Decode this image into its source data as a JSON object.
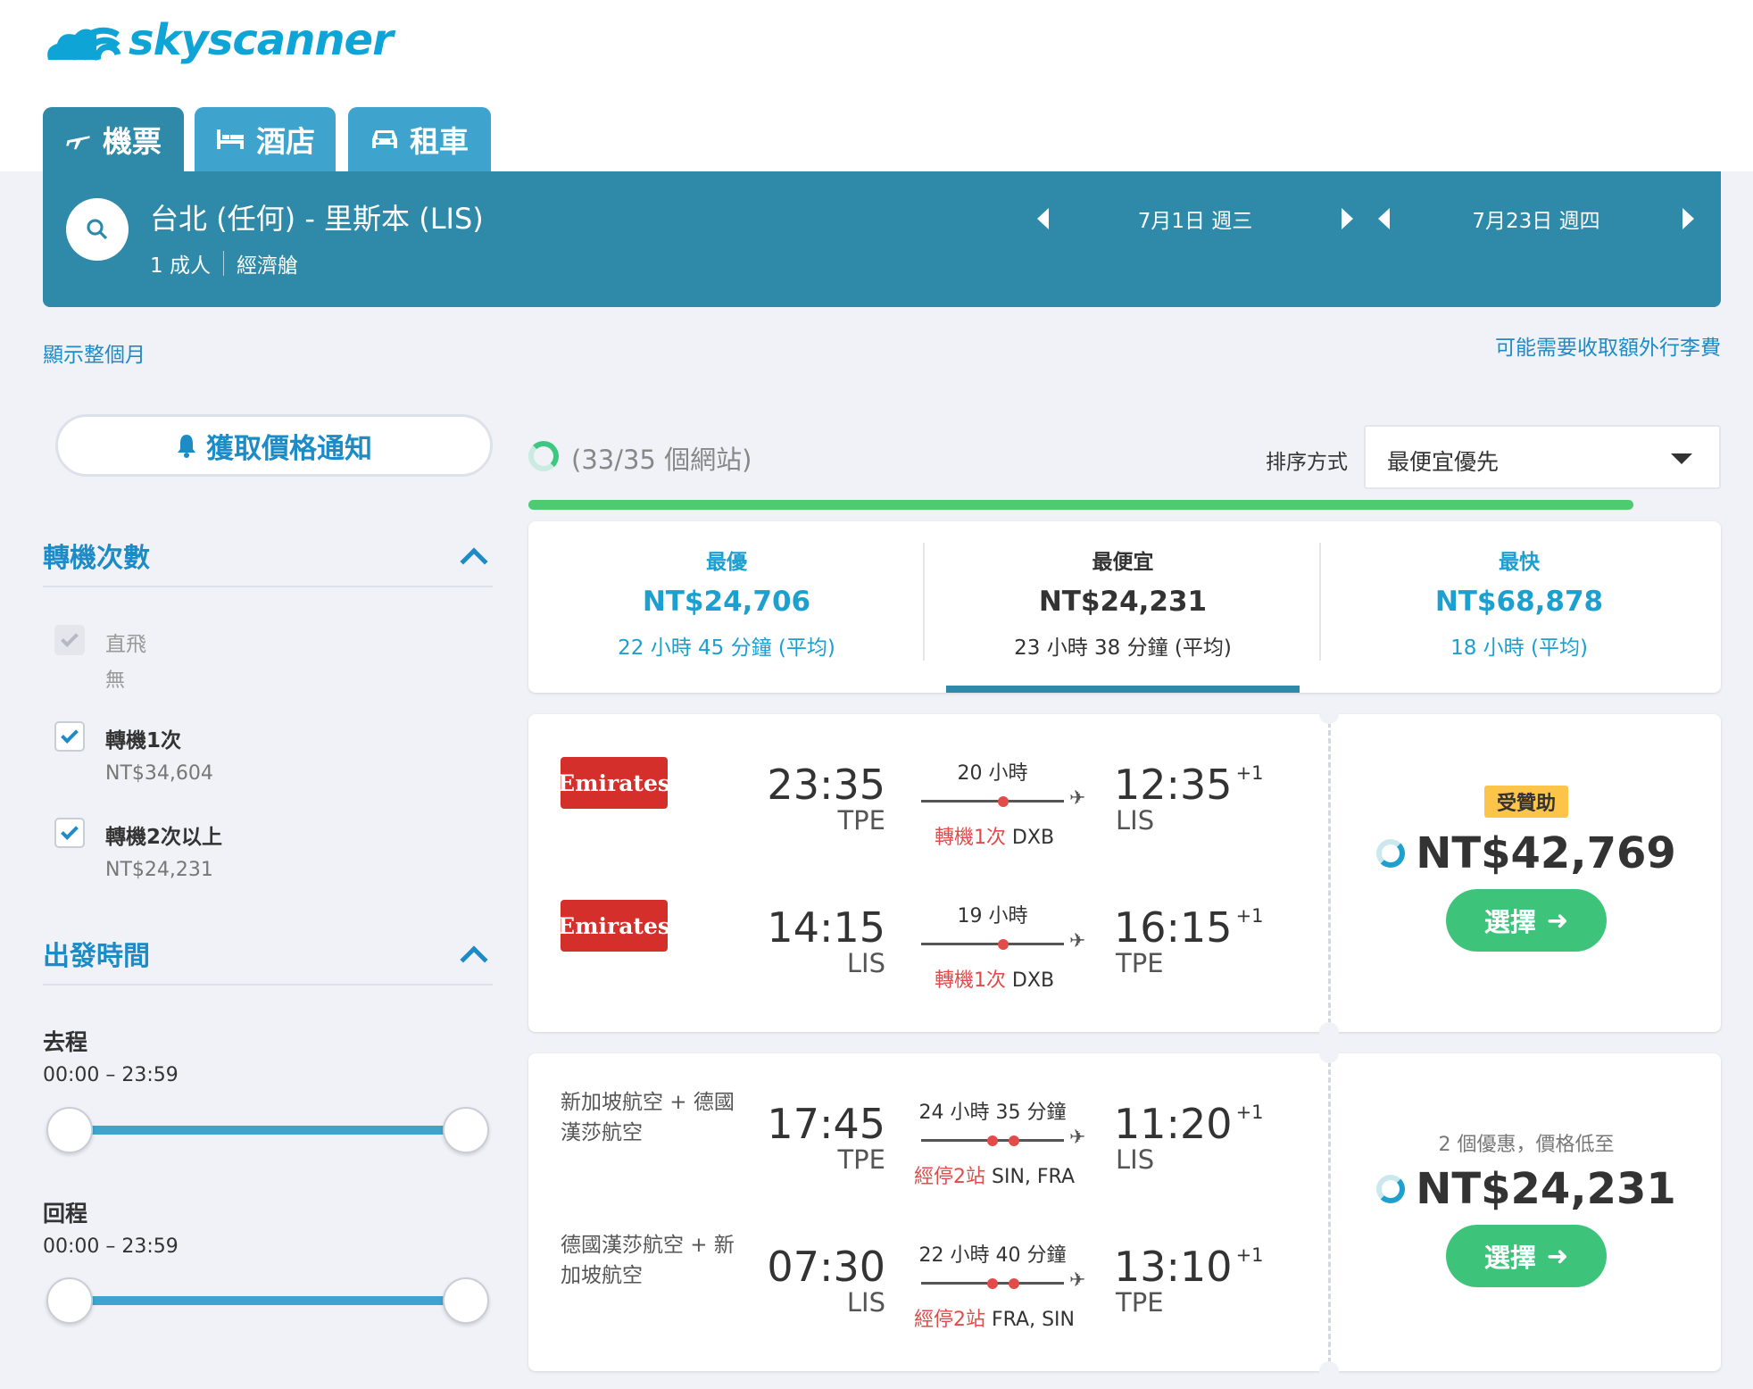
{
  "header": {
    "logo_text": "skyscanner",
    "tabs": [
      {
        "label": "機票",
        "icon": "plane-icon"
      },
      {
        "label": "酒店",
        "icon": "bed-icon"
      },
      {
        "label": "租車",
        "icon": "car-icon"
      }
    ]
  },
  "search": {
    "route": "台北 (任何) - 里斯本 (LIS)",
    "passengers": "1 成人",
    "cabin": "經濟艙",
    "depart_date": "7月1日 週三",
    "return_date": "7月23日 週四"
  },
  "links": {
    "show_month": "顯示整個月",
    "baggage_fee": "可能需要收取額外行李費"
  },
  "sidebar": {
    "price_alert": "獲取價格通知",
    "stops_title": "轉機次數",
    "stops": [
      {
        "label": "直飛",
        "price": "無",
        "checked": true,
        "disabled": true
      },
      {
        "label": "轉機1次",
        "price": "NT$34,604",
        "checked": true,
        "disabled": false
      },
      {
        "label": "轉機2次以上",
        "price": "NT$24,231",
        "checked": true,
        "disabled": false
      }
    ],
    "depart_title": "出發時間",
    "outbound_label": "去程",
    "outbound_range": "00:00 – 23:59",
    "return_label": "回程",
    "return_range": "00:00 – 23:59"
  },
  "results_header": {
    "site_progress": "(33/35 個網站)",
    "sort_label": "排序方式",
    "sort_value": "最便宜優先"
  },
  "summary": [
    {
      "title": "最優",
      "price": "NT$24,706",
      "duration": "22 小時 45 分鐘 (平均)"
    },
    {
      "title": "最便宜",
      "price": "NT$24,231",
      "duration": "23 小時 38 分鐘 (平均)"
    },
    {
      "title": "最快",
      "price": "NT$68,878",
      "duration": "18 小時 (平均)"
    }
  ],
  "results": [
    {
      "badge": "受贊助",
      "price": "NT$42,769",
      "select_label": "選擇",
      "legs": [
        {
          "airline": "Emirates",
          "dep_time": "23:35",
          "dep_airport": "TPE",
          "duration": "20 小時",
          "arr_time": "12:35",
          "day_offset": "+1",
          "arr_airport": "LIS",
          "stops_red": "轉機1次",
          "stops_via": " DXB"
        },
        {
          "airline": "Emirates",
          "dep_time": "14:15",
          "dep_airport": "LIS",
          "duration": "19 小時",
          "arr_time": "16:15",
          "day_offset": "+1",
          "arr_airport": "TPE",
          "stops_red": "轉機1次",
          "stops_via": " DXB"
        }
      ]
    },
    {
      "deal_text": "2 個優惠，價格低至",
      "price": "NT$24,231",
      "select_label": "選擇",
      "legs": [
        {
          "airline": "新加坡航空 + 德國漢莎航空",
          "dep_time": "17:45",
          "dep_airport": "TPE",
          "duration": "24 小時 35 分鐘",
          "arr_time": "11:20",
          "day_offset": "+1",
          "arr_airport": "LIS",
          "stops_red": "經停2站",
          "stops_via": " SIN, FRA"
        },
        {
          "airline": "德國漢莎航空 + 新加坡航空",
          "dep_time": "07:30",
          "dep_airport": "LIS",
          "duration": "22 小時 40 分鐘",
          "arr_time": "13:10",
          "day_offset": "+1",
          "arr_airport": "TPE",
          "stops_red": "經停2站",
          "stops_via": " FRA, SIN"
        }
      ]
    }
  ],
  "colors": {
    "brand": "#0ea5d6",
    "header_bar": "#2e8aa8",
    "accent_blue": "#1d8bc6",
    "select_green": "#3ec47a",
    "stop_red": "#e34b4b",
    "sponsor_yellow": "#fcc54a"
  }
}
